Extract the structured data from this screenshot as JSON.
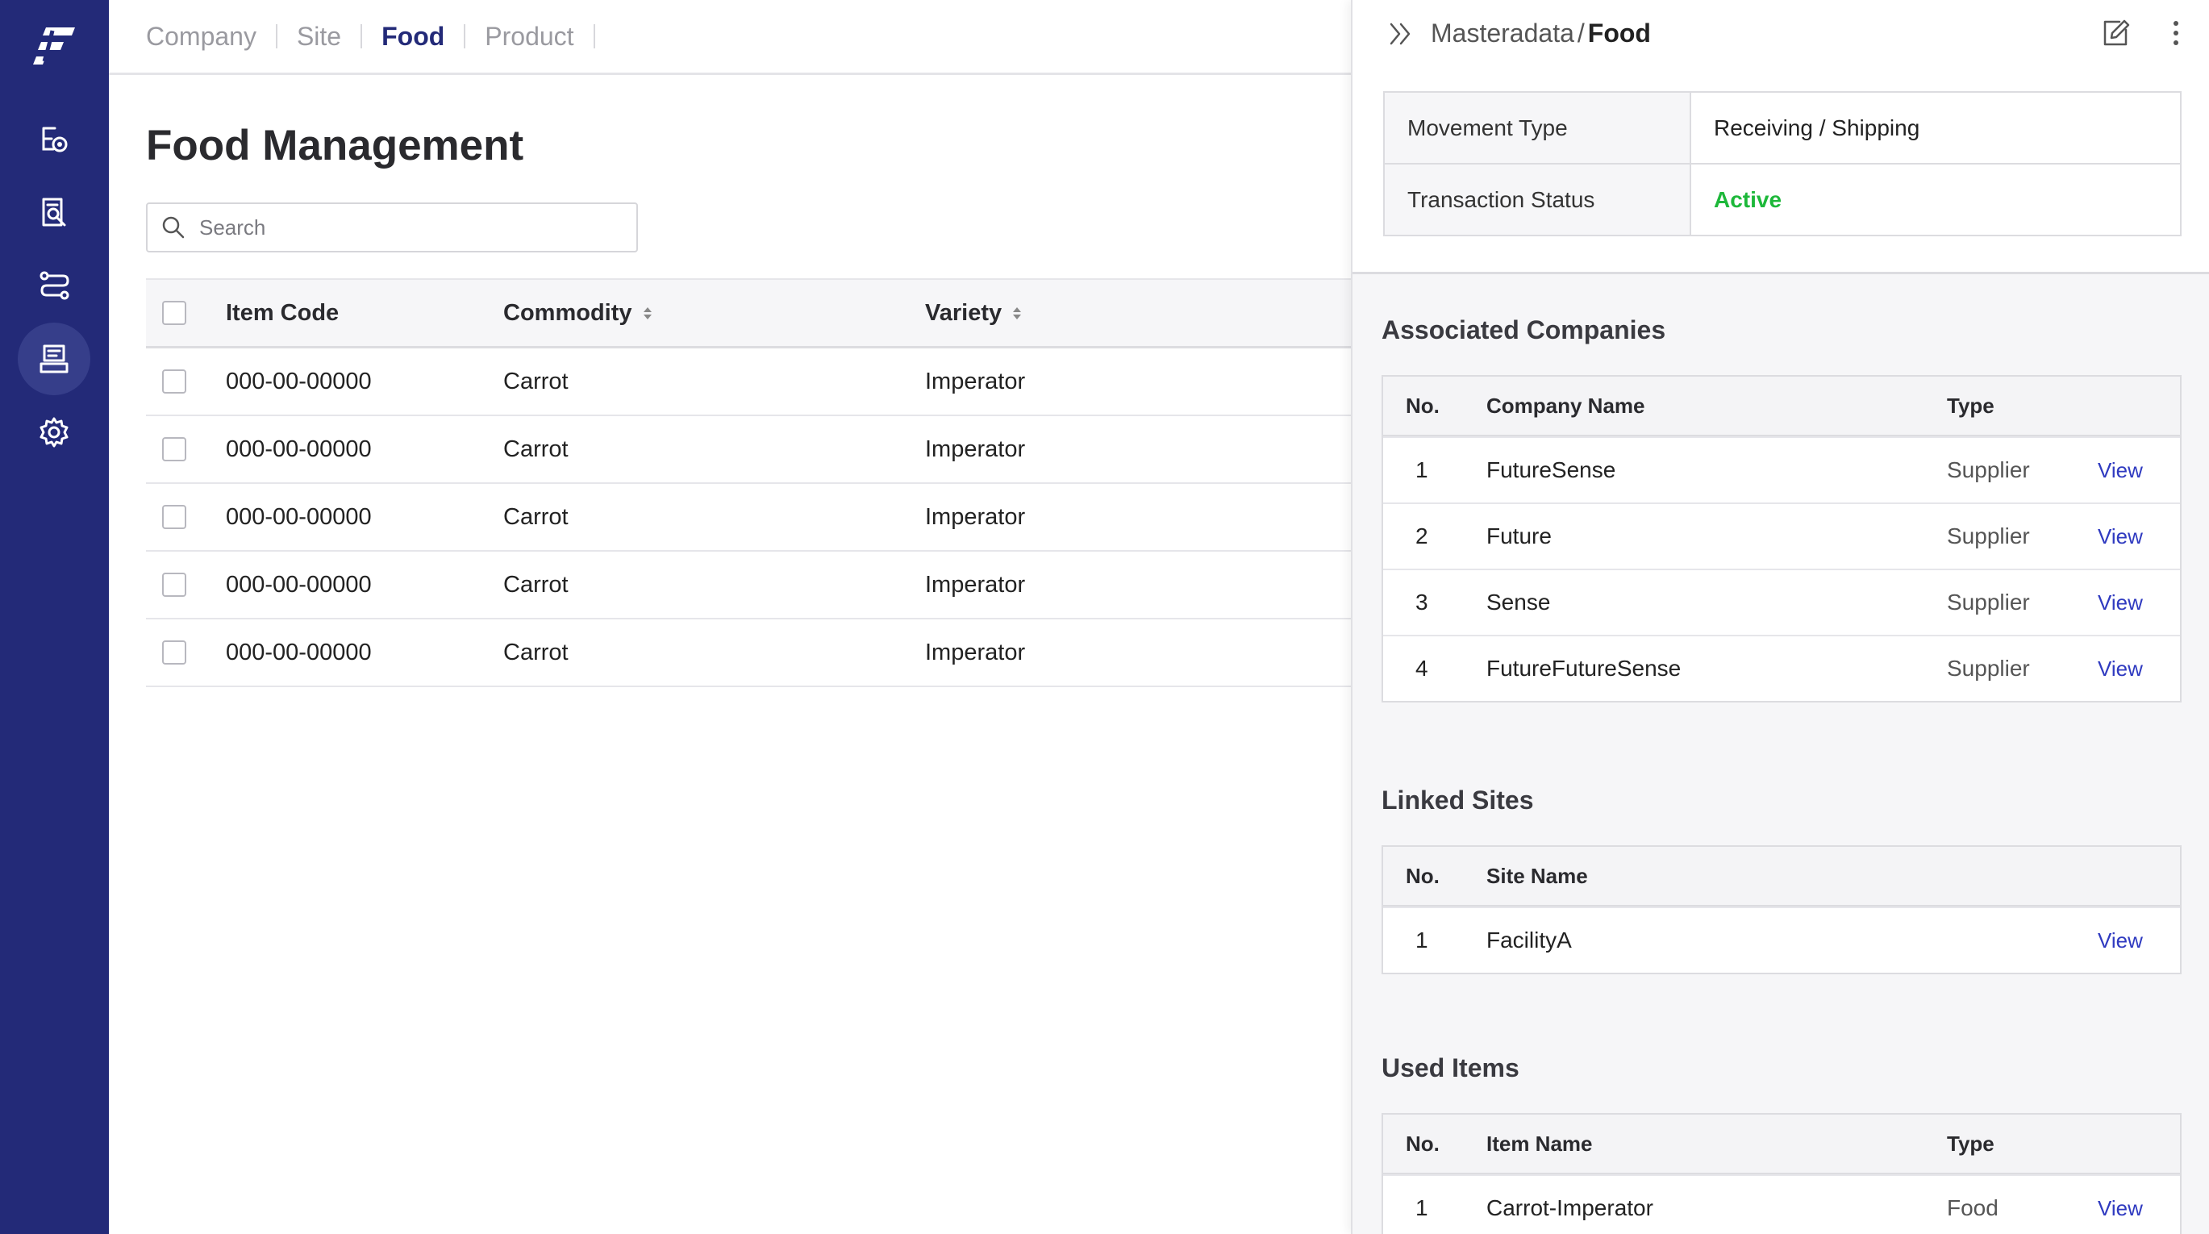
{
  "nav": {
    "tabs": [
      {
        "label": "Company"
      },
      {
        "label": "Site"
      },
      {
        "label": "Food"
      },
      {
        "label": "Product"
      }
    ],
    "active_tab": "Food"
  },
  "sidebar": {
    "background": "#232a78",
    "items": [
      {
        "icon": "workflow-icon"
      },
      {
        "icon": "document-search-icon"
      },
      {
        "icon": "routes-icon"
      },
      {
        "icon": "masterdata-icon",
        "active": true
      },
      {
        "icon": "gear-icon"
      }
    ]
  },
  "page": {
    "title": "Food Management",
    "search_placeholder": "Search"
  },
  "table": {
    "columns": [
      "Item Code",
      "Commodity",
      "Variety"
    ],
    "rows": [
      {
        "item_code": "000-00-00000",
        "commodity": "Carrot",
        "variety": "Imperator"
      },
      {
        "item_code": "000-00-00000",
        "commodity": "Carrot",
        "variety": "Imperator"
      },
      {
        "item_code": "000-00-00000",
        "commodity": "Carrot",
        "variety": "Imperator"
      },
      {
        "item_code": "000-00-00000",
        "commodity": "Carrot",
        "variety": "Imperator"
      },
      {
        "item_code": "000-00-00000",
        "commodity": "Carrot",
        "variety": "Imperator"
      }
    ]
  },
  "panel": {
    "breadcrumb_parent": "Masteradata",
    "breadcrumb_sep": "/",
    "breadcrumb_current": "Food",
    "details": [
      {
        "label": "Movement Type",
        "value": "Receiving / Shipping"
      },
      {
        "label": "Transaction Status",
        "value": "Active"
      }
    ],
    "status_color": "#1db83a",
    "associated_companies": {
      "title": "Associated Companies",
      "headers": [
        "No.",
        "Company Name",
        "Type"
      ],
      "rows": [
        {
          "no": "1",
          "name": "FutureSense",
          "type": "Supplier",
          "action": "View"
        },
        {
          "no": "2",
          "name": "Future",
          "type": "Supplier",
          "action": "View"
        },
        {
          "no": "3",
          "name": "Sense",
          "type": "Supplier",
          "action": "View"
        },
        {
          "no": "4",
          "name": "FutureFutureSense",
          "type": "Supplier",
          "action": "View"
        }
      ]
    },
    "linked_sites": {
      "title": "Linked Sites",
      "headers": [
        "No.",
        "Site Name"
      ],
      "rows": [
        {
          "no": "1",
          "name": "FacilityA",
          "action": "View"
        }
      ]
    },
    "used_items": {
      "title": "Used Items",
      "headers": [
        "No.",
        "Item Name",
        "Type"
      ],
      "rows": [
        {
          "no": "1",
          "name": "Carrot-Imperator",
          "type": "Food",
          "action": "View"
        }
      ]
    }
  }
}
